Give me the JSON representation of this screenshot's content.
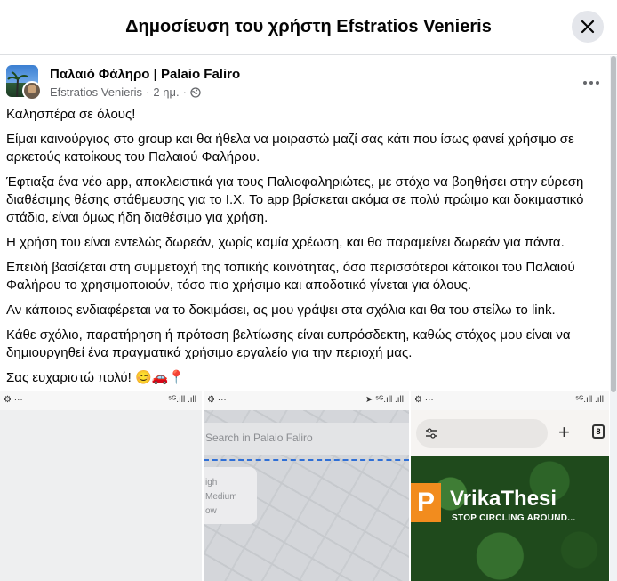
{
  "dialog": {
    "title": "Δημοσίευση του χρήστη Efstratios Venieris",
    "close_icon": "close-icon"
  },
  "post": {
    "group_name": "Παλαιό Φάληρο | Palaio Faliro",
    "author": "Efstratios Venieris",
    "time": "2 ημ.",
    "separator": "·",
    "privacy_icon": "globe-icon",
    "more_icon": "more-options-icon",
    "paragraphs": [
      "Καλησπέρα σε όλους!",
      "Είμαι καινούργιος στο group και θα ήθελα να μοιραστώ μαζί σας κάτι που ίσως φανεί χρήσιμο σε αρκετούς κατοίκους του Παλαιού Φαλήρου.",
      "Έφτιαξα ένα νέο app, αποκλειστικά για τους Παλιοφαληριώτες, με στόχο να βοηθήσει στην εύρεση διαθέσιμης θέσης στάθμευσης για το Ι.Χ. Το app βρίσκεται ακόμα σε πολύ πρώιμο και δοκιμαστικό στάδιο, είναι όμως ήδη διαθέσιμο για χρήση.",
      "Η χρήση του είναι εντελώς δωρεάν, χωρίς καμία χρέωση, και θα παραμείνει δωρεάν για πάντα.",
      "Επειδή βασίζεται στη συμμετοχή της τοπικής κοινότητας, όσο περισσότεροι κάτοικοι του Παλαιού Φαλήρου το χρησιμοποιούν, τόσο πιο χρήσιμο και αποδοτικό γίνεται για όλους.",
      "Αν κάποιος ενδιαφέρεται να το δοκιμάσει, ας μου γράψει στα σχόλια και θα του στείλω το link.",
      "Κάθε σχόλιο, παρατήρηση ή πρόταση βελτίωσης είναι ευπρόσδεκτη, καθώς στόχος μου είναι να δημιουργηθεί ένα πραγματικά χρήσιμο εργαλείο για την περιοχή μας.",
      "Σας ευχαριστώ πολύ! 😊🚗📍"
    ]
  },
  "images": {
    "tile1": {
      "status_left": "⚙ ···",
      "status_right": "⁵ᴳ.ıll .ıll"
    },
    "tile2": {
      "status_left": "⚙ ···",
      "status_right": "➤ ⁵ᴳ.ıll .ıll",
      "search_placeholder": "Search in Palaio Faliro",
      "legend": [
        "igh",
        "Medium",
        "ow"
      ]
    },
    "tile3": {
      "status_left": "⚙ ···",
      "status_right": "⁵ᴳ.ıll .ıll",
      "tabs_count": "8",
      "logo_letter": "P",
      "app_name": "VrikaThesi",
      "tagline": "STOP CIRCLING AROUND..."
    }
  },
  "colors": {
    "accent_orange": "#f28c1e",
    "forest_green": "#1f4a1c",
    "secondary_text": "#65676b"
  }
}
